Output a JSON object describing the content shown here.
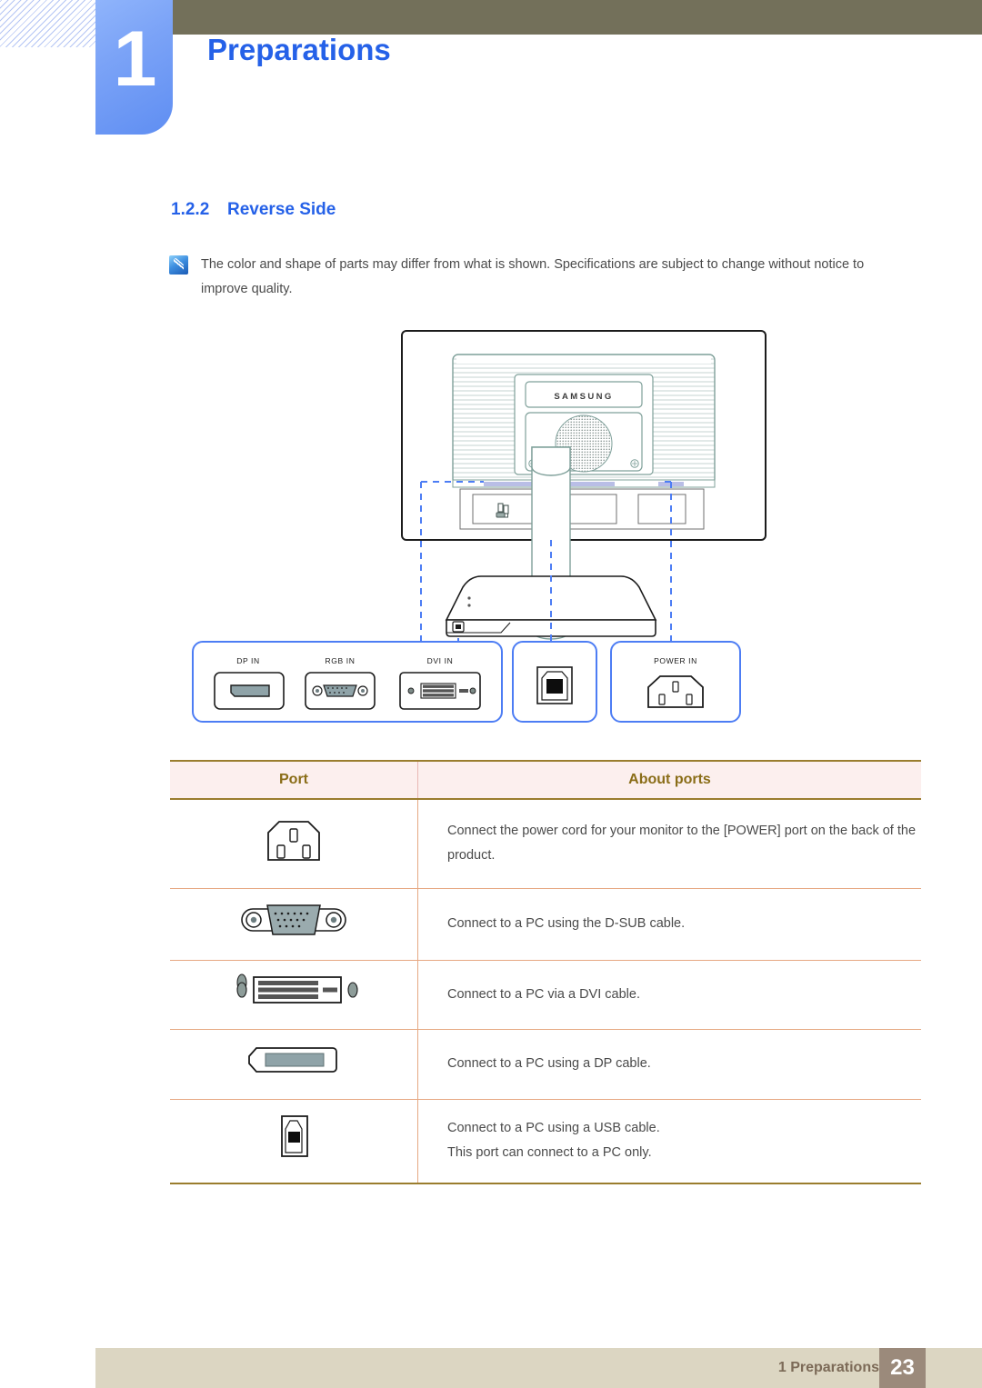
{
  "chapter": {
    "number": "1",
    "title": "Preparations"
  },
  "section": {
    "number": "1.2.2",
    "title": "Reverse Side"
  },
  "note": {
    "icon": "note-icon",
    "text": "The color and shape of parts may differ from what is shown. Specifications are subject to change without notice to improve quality."
  },
  "illustration": {
    "brand_logo": "SAMSUNG",
    "callouts": [
      {
        "label": "DP IN"
      },
      {
        "label": "RGB IN"
      },
      {
        "label": "DVI IN"
      },
      {
        "label": ""
      },
      {
        "label": "POWER IN"
      }
    ]
  },
  "table": {
    "headers": [
      "Port",
      "About ports"
    ],
    "rows": [
      {
        "port_icon": "power-in-port-icon",
        "lines": [
          "Connect the power cord for your monitor to the [POWER] port on the back of the product."
        ]
      },
      {
        "port_icon": "d-sub-rgb-port-icon",
        "lines": [
          "Connect to a PC using the D-SUB cable."
        ]
      },
      {
        "port_icon": "dvi-port-icon",
        "lines": [
          "Connect to a PC via a DVI cable."
        ]
      },
      {
        "port_icon": "displayport-port-icon",
        "lines": [
          "Connect to a PC using a DP cable."
        ]
      },
      {
        "port_icon": "usb-b-port-icon",
        "lines": [
          "Connect to a PC using a USB cable.",
          "This port can connect to a PC only."
        ]
      }
    ]
  },
  "footer": {
    "text": "1 Preparations",
    "page": "23"
  },
  "colors": {
    "accent_blue": "#2561e8",
    "tab_blue": "#6f99f5",
    "olive": "#73705a",
    "table_header_bg": "#fcefee",
    "table_header_text": "#8a6d18",
    "table_border": "#9a7d2e",
    "footer_bg": "#dcd6c2",
    "page_box_bg": "#9b8a7b"
  }
}
